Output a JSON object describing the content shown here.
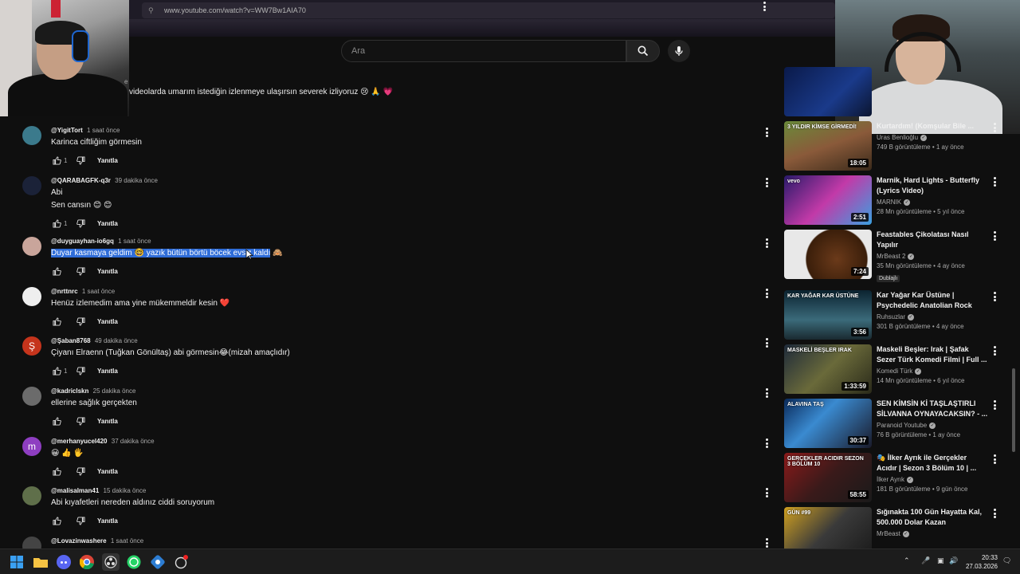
{
  "browser": {
    "url": "www.youtube.com/watch?v=WW7Bw1AIA70"
  },
  "search": {
    "placeholder": "Ara"
  },
  "top_comment": {
    "text": "videolarda umarım istediğin izlenmeye ulaşırsın severek izliyoruz 😢 🙏 💗",
    "partial_label": "e"
  },
  "reply_label": "Yanıtla",
  "comments": [
    {
      "author": "@YigitTort",
      "time": "1 saat önce",
      "lines": [
        "Karinca ciftliğim görmesin"
      ],
      "likes": "1"
    },
    {
      "author": "@QARABAGFK-q3r",
      "time": "39 dakika önce",
      "lines": [
        "Abi",
        "Sen cansın 😊 😊"
      ],
      "likes": "1"
    },
    {
      "author": "@duyguayhan-io6gq",
      "time": "1 saat önce",
      "highlight": "Duyar kasmaya geldim 🤓 yazık bütün börtü böcek evsiz kaldı",
      "tail": " 🙈",
      "likes": ""
    },
    {
      "author": "@nrttnrc",
      "time": "1 saat önce",
      "lines": [
        "Henüz izlemedim ama yine mükemmeldir kesin ❤️"
      ],
      "likes": ""
    },
    {
      "author": "@Şaban8768",
      "time": "49 dakika önce",
      "lines": [
        "Çiyanı Elraenn (Tuğkan Gönültaş) abi görmesin😂(mizah amaçlıdır)"
      ],
      "likes": "1",
      "avatar_letter": "Ş"
    },
    {
      "author": "@kadriclskn",
      "time": "25 dakika önce",
      "lines": [
        "ellerine sağlık gerçekten"
      ],
      "likes": ""
    },
    {
      "author": "@merhanyucel420",
      "time": "37 dakika önce",
      "lines": [
        "😀 👍 🖐"
      ],
      "likes": "",
      "avatar_letter": "m"
    },
    {
      "author": "@malisalman41",
      "time": "15 dakika önce",
      "lines": [
        "Abi kıyafetleri nereden aldınız ciddi soruyorum"
      ],
      "likes": ""
    },
    {
      "author": "@Lovazinwashere",
      "time": "1 saat önce",
      "lines": [
        ""
      ],
      "likes": ""
    }
  ],
  "videos": [
    {
      "title": "",
      "channel": "",
      "meta": "",
      "duration": ""
    },
    {
      "title": "Kurtardım! (Komşular Bile ...",
      "channel": "Uras Benlioğlu",
      "meta": "749 B görüntüleme • 1 ay önce",
      "duration": "18:05",
      "thumb_text": "3 YILDIR KİMSE GİRMEDİ!"
    },
    {
      "title": "Marnik, Hard Lights - Butterfly (Lyrics Video)",
      "channel": "MARNIK",
      "meta": "28 Mn görüntüleme • 5 yıl önce",
      "duration": "2:51",
      "thumb_text": "vevo"
    },
    {
      "title": "Feastables Çikolatası Nasıl Yapılır",
      "channel": "MrBeast 2",
      "meta": "35 Mn görüntüleme • 4 ay önce",
      "duration": "7:24",
      "badge": "Dublajlı"
    },
    {
      "title": "Kar Yağar Kar Üstüne | Psychedelic Anatolian Rock",
      "channel": "Ruhsuzlar",
      "meta": "301 B görüntüleme • 4 ay önce",
      "duration": "3:56",
      "thumb_text": "KAR YAĞAR KAR ÜSTÜNE"
    },
    {
      "title": "Maskeli Beşler: Irak | Şafak Sezer Türk Komedi Filmi | Full ...",
      "channel": "Komedi Türk",
      "meta": "14 Mn görüntüleme • 6 yıl önce",
      "duration": "1:33:59",
      "thumb_text": "MASKELİ BEŞLER IRAK"
    },
    {
      "title": "SEN KİMSİN Kİ TAŞLAŞTIRLI SİLVANNA OYNAYACAKSIN? - ...",
      "channel": "Paranoid Youtube",
      "meta": "76 B görüntüleme • 1 ay önce",
      "duration": "30:37",
      "thumb_text": "ALAVINA TAŞ"
    },
    {
      "title": "🎭 İlker Ayrık ile Gerçekler Acıdır | Sezon 3 Bölüm 10 | ...",
      "channel": "İlker Ayrık",
      "meta": "181 B görüntüleme • 9 gün önce",
      "duration": "58:55",
      "thumb_text": "GERÇEKLER ACIDIR SEZON 3 BÖLÜM 10"
    },
    {
      "title": "Sığınakta 100 Gün Hayatta Kal, 500.000 Dolar Kazan",
      "channel": "MrBeast",
      "meta": "",
      "duration": "",
      "thumb_text": "GÜN #99"
    }
  ],
  "taskbar": {
    "time": "20:33",
    "date": "27.03.2026"
  },
  "colors": {
    "background": "#0f0f0f",
    "highlight": "#2f6dd8",
    "heart": "#e0245e"
  }
}
